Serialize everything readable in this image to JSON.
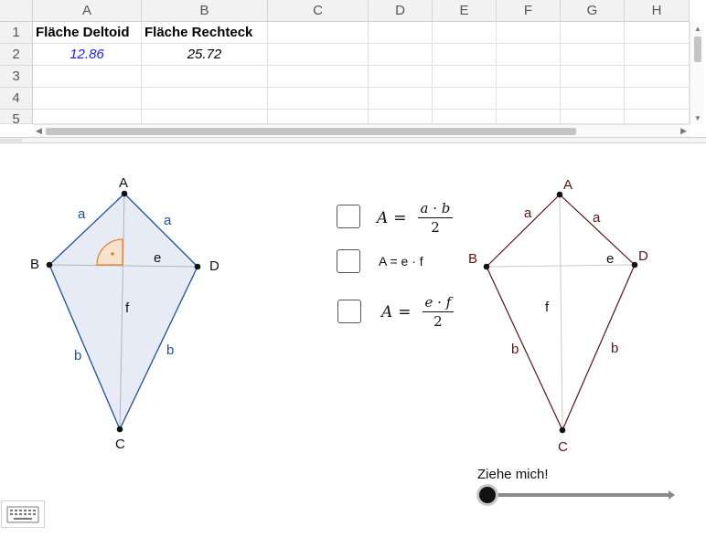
{
  "spreadsheet": {
    "columns": [
      "A",
      "B",
      "C",
      "D",
      "E",
      "F",
      "G",
      "H"
    ],
    "rows": [
      "1",
      "2",
      "3",
      "4",
      "5"
    ],
    "cells": {
      "A1": "Fläche Deltoid",
      "B1": "Fläche Rechteck",
      "A2": "12.86",
      "B2": "25.72"
    },
    "colors": {
      "A2": "#1a1aff",
      "B2": "#000000"
    }
  },
  "left_kite": {
    "vertices": {
      "A": "A",
      "B": "B",
      "C": "C",
      "D": "D"
    },
    "sides": {
      "ab": "a",
      "ad": "a",
      "bc": "b",
      "dc": "b"
    },
    "diagonals": {
      "e": "e",
      "f": "f"
    },
    "color": "#1f4e9c",
    "fill": "#e6ebf6",
    "angle_color": "#e8801a"
  },
  "right_kite": {
    "vertices": {
      "A": "A",
      "B": "B",
      "C": "C",
      "D": "D"
    },
    "sides": {
      "ab": "a",
      "ad": "a",
      "bc": "b",
      "dc": "b"
    },
    "diagonals": {
      "e": "e",
      "f": "f"
    },
    "color": "#5a1414"
  },
  "options": {
    "formula1": {
      "lhs": "A",
      "num": "a · b",
      "den": "2"
    },
    "formula2": "A = e · f",
    "formula3": {
      "lhs": "A",
      "num": "e · f",
      "den": "2"
    }
  },
  "slider": {
    "label": "Ziehe mich!",
    "value": 0
  },
  "icons": {
    "keyboard": "keyboard-icon"
  }
}
